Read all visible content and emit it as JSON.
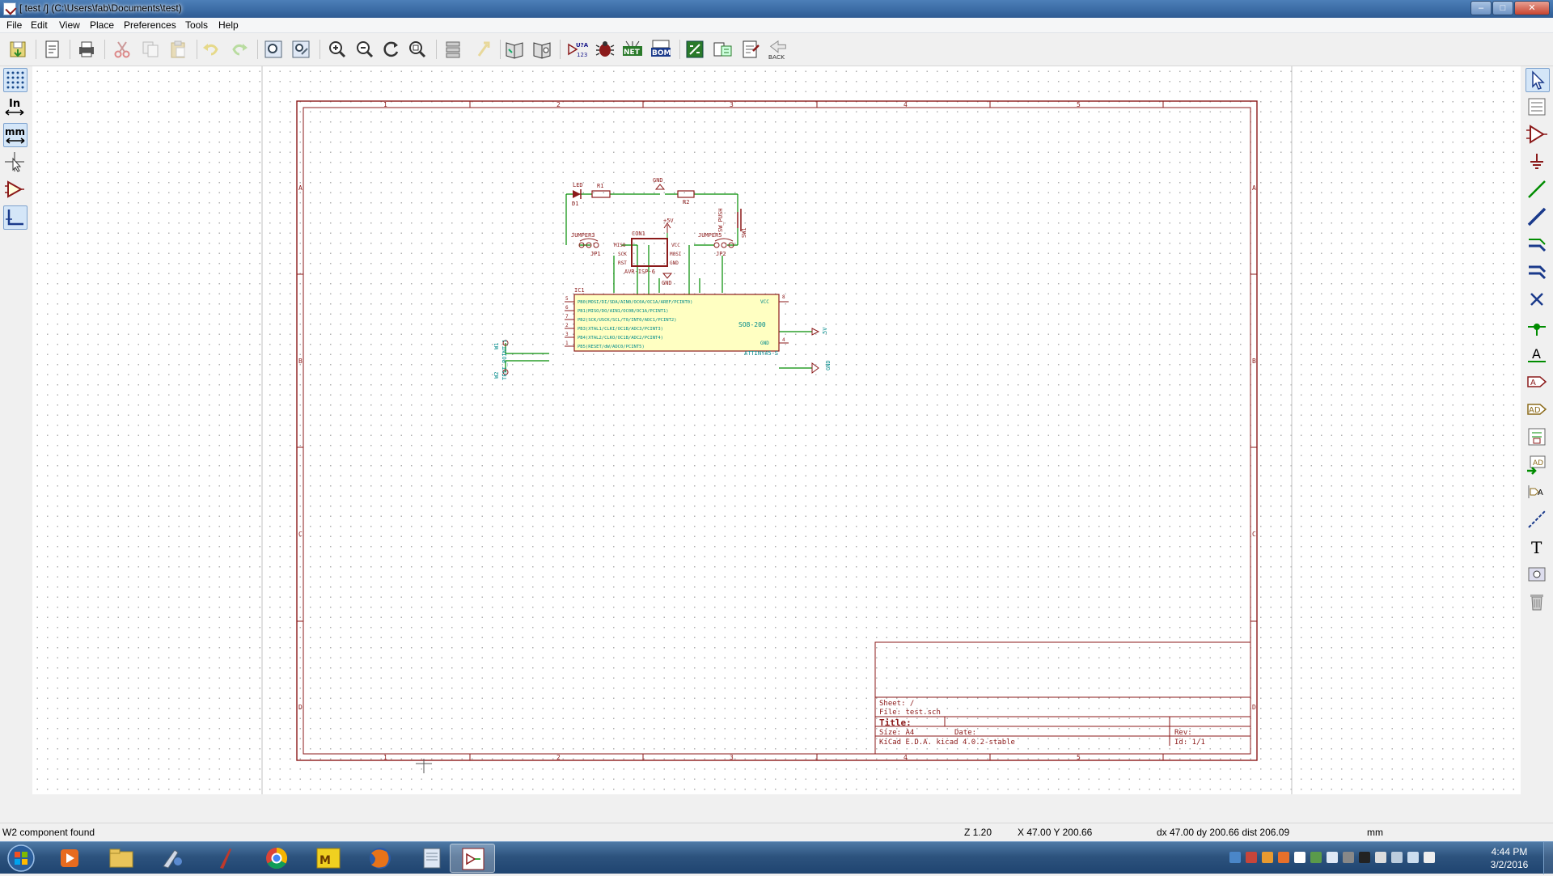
{
  "window": {
    "title": "[ test /] (C:\\Users\\fab\\Documents\\test)",
    "buttons": [
      "–",
      "□",
      "✕"
    ]
  },
  "menu": [
    "File",
    "Edit",
    "View",
    "Place",
    "Preferences",
    "Tools",
    "Help"
  ],
  "toolbar": {
    "icons": [
      "save-icon",
      "new-sheet-icon",
      "print-icon",
      "cut-icon",
      "copy-icon",
      "paste-icon",
      "undo-icon",
      "redo-icon",
      "find-icon",
      "find-replace-icon",
      "zoom-in-icon",
      "zoom-out-icon",
      "zoom-redraw-icon",
      "zoom-fit-icon",
      "hierarchy-icon",
      "leave-sheet-icon",
      "library-editor-icon",
      "library-browser-icon",
      "annotate-icon",
      "erc-icon",
      "netlist-icon",
      "bom-icon",
      "cvpcb-icon",
      "import-footprint-icon",
      "pcbnew-icon",
      "back-annotate-icon"
    ],
    "labels": {
      "annotate": "U?A 123",
      "netlist": "NET",
      "bom": "BOM",
      "back": "BACK"
    }
  },
  "lefttools": {
    "labels": {
      "inches": "In",
      "mm": "mm"
    },
    "icons": [
      "grid-icon",
      "inches-icon",
      "millimeters-icon",
      "cursor-shape-icon",
      "hidden-pins-icon",
      "wire-orientation-icon"
    ]
  },
  "righttools": {
    "icons": [
      "select-arrow-icon",
      "hierarchy-navigator-icon",
      "add-component-icon",
      "add-power-icon",
      "add-wire-icon",
      "add-bus-icon",
      "wire-to-bus-entry-icon",
      "bus-to-bus-entry-icon",
      "no-connect-icon",
      "junction-icon",
      "net-label-icon",
      "global-label-icon",
      "hierarchical-label-icon",
      "hierarchical-sheet-icon",
      "import-sheet-pin-icon",
      "sheet-pin-icon",
      "graphic-line-icon",
      "text-icon",
      "image-icon",
      "delete-icon"
    ],
    "labels": {
      "netlabel": "A",
      "text": "T"
    }
  },
  "sheet": {
    "col_labels": [
      "1",
      "2",
      "3",
      "4",
      "5"
    ],
    "row_labels": [
      "A",
      "B",
      "C",
      "D"
    ],
    "title_block": {
      "sheet": "Sheet: /",
      "file": "File: test.sch",
      "title": "Title:",
      "size": "Size: A4",
      "date": "Date:",
      "rev": "Rev:",
      "kicad": "KiCad E.D.A.  kicad 4.0.2-stable",
      "id": "Id: 1/1"
    }
  },
  "schematic": {
    "labels": {
      "led": "LED",
      "d1": "D1",
      "r1": "R1",
      "r2": "R2",
      "gnd_top": "GND",
      "plus5v": "+5V",
      "jumper3": "JUMPER3",
      "jp1": "JP1",
      "jumper5": "JUMPER5",
      "jp2": "JP2",
      "sw_push": "SW_PUSH",
      "sw1": "SW1",
      "con1": "CON1",
      "avr_isp": "AVR-ISP-6",
      "miso": "MISO",
      "sck": "SCK",
      "rst": "RST",
      "vcc_pin": "VCC",
      "mosi": "MOSI",
      "gnd_pin": "GND",
      "gnd_bottom": "GND",
      "ic1": "IC1",
      "so8": "SO8-200",
      "attiny": "ATTINY45-S",
      "ic_vcc": "VCC",
      "ic_gnd": "GND",
      "pwr_5v": "5V",
      "pwr_gnd": "GND",
      "w1": "W1",
      "w2": "W2",
      "test_point": "TEST_POINT_1"
    },
    "ic_pins": [
      {
        "num": "5",
        "name": "PB0(MOSI/DI/SDA/AIN0/OC0A/OC1A/AREF/PCINT0)"
      },
      {
        "num": "6",
        "name": "PB1(MISO/DO/AIN1/OC0B/OC1A/PCINT1)"
      },
      {
        "num": "7",
        "name": "PB2(SCK/USCK/SCL/T0/INT0/ADC1/PCINT2)"
      },
      {
        "num": "2",
        "name": "PB3(XTAL1/CLKI/OC1B/ADC3/PCINT3)"
      },
      {
        "num": "3",
        "name": "PB4(XTAL2/CLKO/OC1B/ADC2/PCINT4)"
      },
      {
        "num": "1",
        "name": "PB5(RESET/dW/ADC0/PCINT5)"
      }
    ],
    "ic_right_pins": [
      "8",
      "4"
    ]
  },
  "status": {
    "message": "W2 component found",
    "zoom": "Z 1.20",
    "coords": "X 47.00  Y 200.66",
    "delta": "dx 47.00  dy 200.66  dist 206.09",
    "units": "mm"
  },
  "taskbar": {
    "apps": [
      "media-player-icon",
      "file-explorer-icon",
      "paint-tool-icon",
      "pen-tool-icon",
      "chrome-icon",
      "matlab-icon",
      "firefox-icon",
      "notepad-icon",
      "kicad-eeschema-icon"
    ],
    "clock_time": "4:44 PM",
    "clock_date": "3/2/2016"
  },
  "colors": {
    "sheet_border": "#8b1a1a",
    "component": "#8b1a1a",
    "wire": "#008c00",
    "label": "#006a6a",
    "ic_fill": "#ffffc2"
  }
}
